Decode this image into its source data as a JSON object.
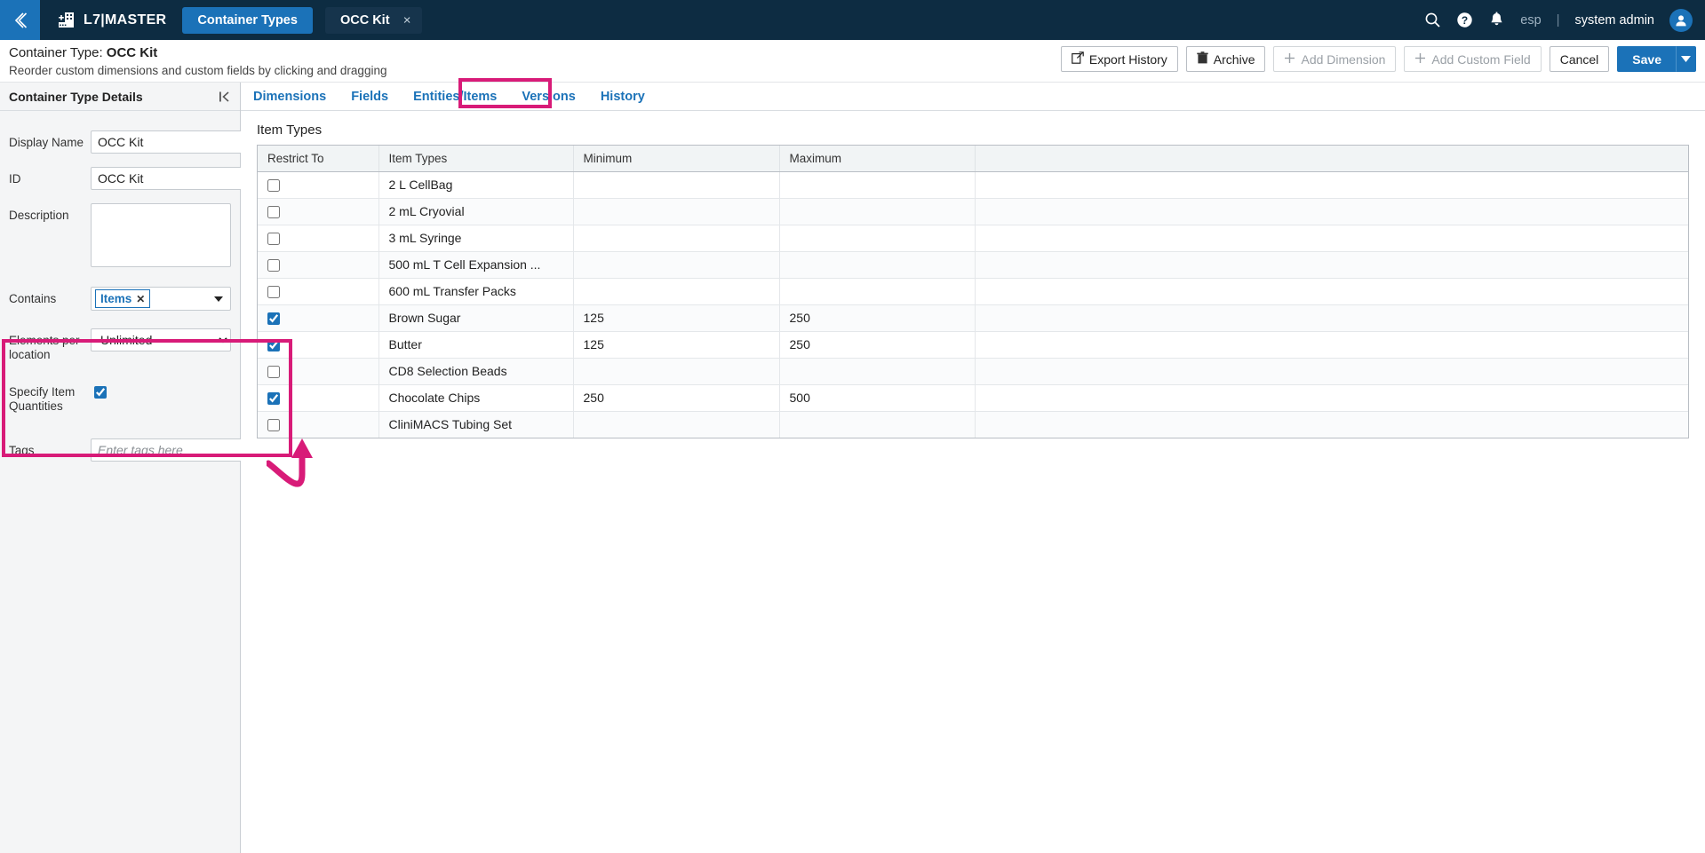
{
  "topnav": {
    "back_icon": "chevron-left-icon",
    "brand_icon": "building-add-icon",
    "brand": "L7|MASTER",
    "tabs": [
      {
        "label": "Container Types",
        "active": true
      },
      {
        "label": "OCC Kit",
        "active": false,
        "closable": true,
        "close_glyph": "×"
      }
    ],
    "search_icon": "search-icon",
    "help_icon": "help-circle-icon",
    "notifications_icon": "bell-icon",
    "locale": "esp",
    "separator": "|",
    "user": "system admin",
    "avatar_icon": "user-avatar-icon"
  },
  "page_header": {
    "title_prefix": "Container Type: ",
    "title_value": "OCC Kit",
    "subtitle": "Reorder custom dimensions and custom fields by clicking and dragging",
    "actions": [
      {
        "label": "Export History",
        "icon": "external-link-icon",
        "disabled": false
      },
      {
        "label": "Archive",
        "icon": "trash-icon",
        "disabled": false
      },
      {
        "label": "Add Dimension",
        "icon": "plus-icon",
        "disabled": true
      },
      {
        "label": "Add Custom Field",
        "icon": "plus-icon",
        "disabled": true
      },
      {
        "label": "Cancel",
        "icon": "",
        "disabled": false
      }
    ],
    "save_label": "Save",
    "save_caret_icon": "chevron-down-icon"
  },
  "tabs": [
    {
      "label": "Dimensions",
      "active": false
    },
    {
      "label": "Fields",
      "active": false
    },
    {
      "label": "Entities/Items",
      "active": true,
      "highlighted": true
    },
    {
      "label": "Versions",
      "active": false
    },
    {
      "label": "History",
      "active": false
    }
  ],
  "sidebar": {
    "header": "Container Type Details",
    "collapse_icon": "collapse-panel-icon",
    "fields": {
      "display_name_label": "Display Name",
      "display_name_value": "OCC Kit",
      "id_label": "ID",
      "id_value": "OCC Kit",
      "description_label": "Description",
      "description_value": "",
      "contains_label": "Contains",
      "contains_chip": "Items",
      "contains_chip_remove": "✕",
      "contains_caret_icon": "dropdown-caret-icon",
      "elements_label": "Elements per location",
      "elements_value": "Unlimited",
      "specify_label": "Specify Item Quantities",
      "specify_checked": true,
      "tags_label": "Tags",
      "tags_value": "",
      "tags_placeholder": "Enter tags here"
    }
  },
  "main": {
    "section_title": "Item Types",
    "table": {
      "columns": [
        "Restrict To",
        "Item Types",
        "Minimum",
        "Maximum",
        ""
      ],
      "rows": [
        {
          "restrict": false,
          "type": "2 L CellBag",
          "min": "",
          "max": ""
        },
        {
          "restrict": false,
          "type": "2 mL Cryovial",
          "min": "",
          "max": ""
        },
        {
          "restrict": false,
          "type": "3 mL Syringe",
          "min": "",
          "max": ""
        },
        {
          "restrict": false,
          "type": "500 mL T Cell Expansion ...",
          "min": "",
          "max": ""
        },
        {
          "restrict": false,
          "type": "600 mL Transfer Packs",
          "min": "",
          "max": ""
        },
        {
          "restrict": true,
          "type": "Brown Sugar",
          "min": "125",
          "max": "250"
        },
        {
          "restrict": true,
          "type": "Butter",
          "min": "125",
          "max": "250"
        },
        {
          "restrict": false,
          "type": "CD8 Selection Beads",
          "min": "",
          "max": ""
        },
        {
          "restrict": true,
          "type": "Chocolate Chips",
          "min": "250",
          "max": "500"
        },
        {
          "restrict": false,
          "type": "CliniMACS Tubing Set",
          "min": "",
          "max": ""
        }
      ]
    }
  },
  "annotations": {
    "highlight_color": "#d81b78",
    "arrow_icon": "curved-arrow-up-icon"
  },
  "colors": {
    "topbar_bg": "#0d2c42",
    "accent_blue": "#1b72b8",
    "highlight_pink": "#d81b78"
  }
}
